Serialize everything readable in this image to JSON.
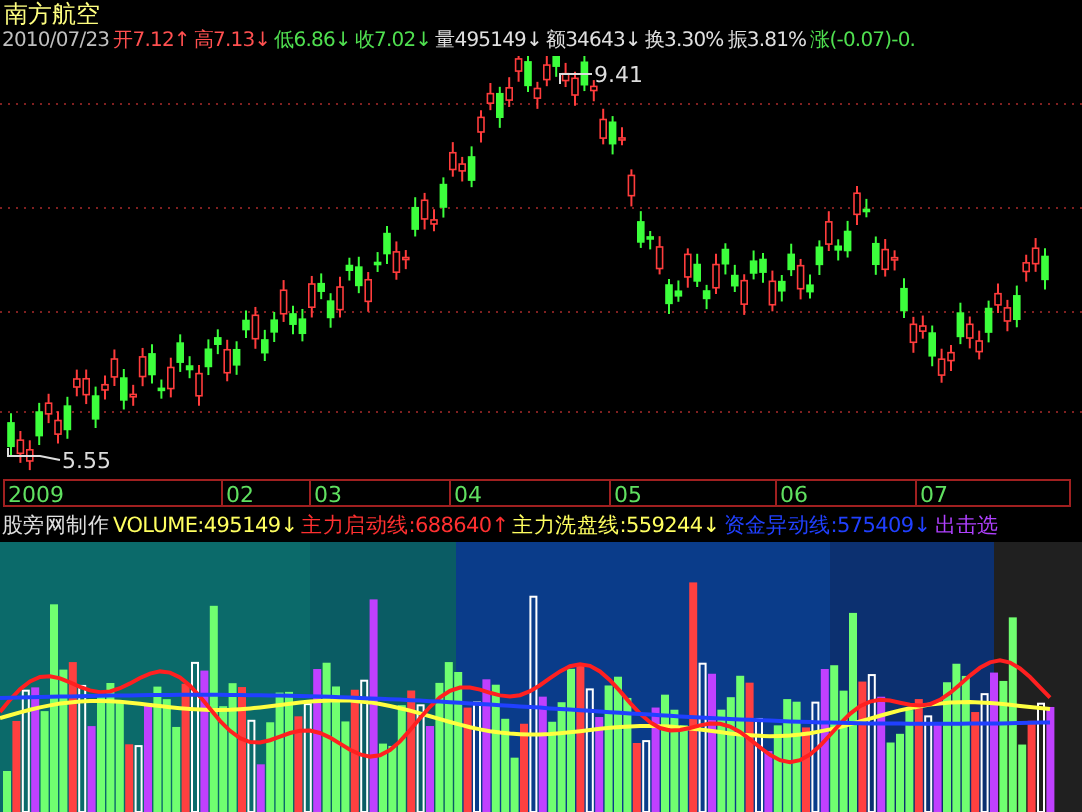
{
  "stock_name": "南方航空",
  "quote": [
    {
      "label": "2010/07/23",
      "color": "#c0c0c0"
    },
    {
      "label": "开7.12",
      "arrow": "↑",
      "color": "#ff5050"
    },
    {
      "label": "高7.13",
      "arrow": "↓",
      "color": "#ff5050"
    },
    {
      "label": "低6.86",
      "arrow": "↓",
      "color": "#50e050"
    },
    {
      "label": "收7.02",
      "arrow": "↓",
      "color": "#50e050"
    },
    {
      "label": "量495149",
      "arrow": "↓",
      "color": "#e0e0e0"
    },
    {
      "label": "额34643",
      "arrow": "↓",
      "color": "#e0e0e0"
    },
    {
      "label": "换3.30%",
      "color": "#e0e0e0"
    },
    {
      "label": "振3.81%",
      "color": "#e0e0e0"
    },
    {
      "label": "涨(-0.07)-0.",
      "color": "#50e050"
    }
  ],
  "price_chart": {
    "high_label": "9.41",
    "low_label": "5.55"
  },
  "time_axis": [
    "2009",
    "02",
    "03",
    "04",
    "05",
    "06",
    "07"
  ],
  "indicator_legend": [
    {
      "label": "股旁网制作",
      "color": "#e0e0e0"
    },
    {
      "label": "VOLUME:495149",
      "arrow": "↓",
      "color": "#ffff60"
    },
    {
      "label": "主力启动线:688640",
      "arrow": "↑",
      "color": "#ff3030"
    },
    {
      "label": "主力洗盘线:559244",
      "arrow": "↓",
      "color": "#ffff60"
    },
    {
      "label": "资金异动线:575409",
      "arrow": "↓",
      "color": "#2040ff"
    },
    {
      "label": "出击选",
      "color": "#b040ff"
    }
  ]
}
